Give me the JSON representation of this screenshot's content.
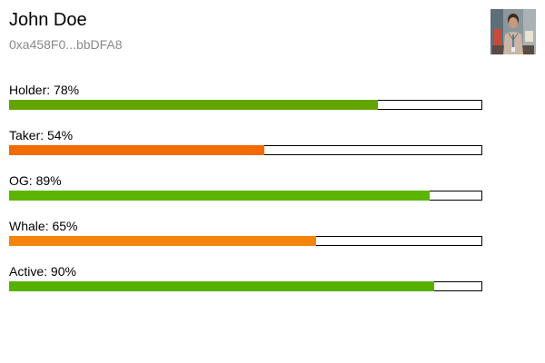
{
  "profile": {
    "name": "John Doe",
    "address": "0xa458F0...bbDFA8"
  },
  "stats": [
    {
      "label": "Holder",
      "value": 78,
      "display": "78%",
      "color": "#62a400"
    },
    {
      "label": "Taker",
      "value": 54,
      "display": "54%",
      "color": "#f26a00"
    },
    {
      "label": "OG",
      "value": 89,
      "display": "89%",
      "color": "#5bb400"
    },
    {
      "label": "Whale",
      "value": 65,
      "display": "65%",
      "color": "#f5850a"
    },
    {
      "label": "Active",
      "value": 90,
      "display": "90%",
      "color": "#56b000"
    }
  ]
}
